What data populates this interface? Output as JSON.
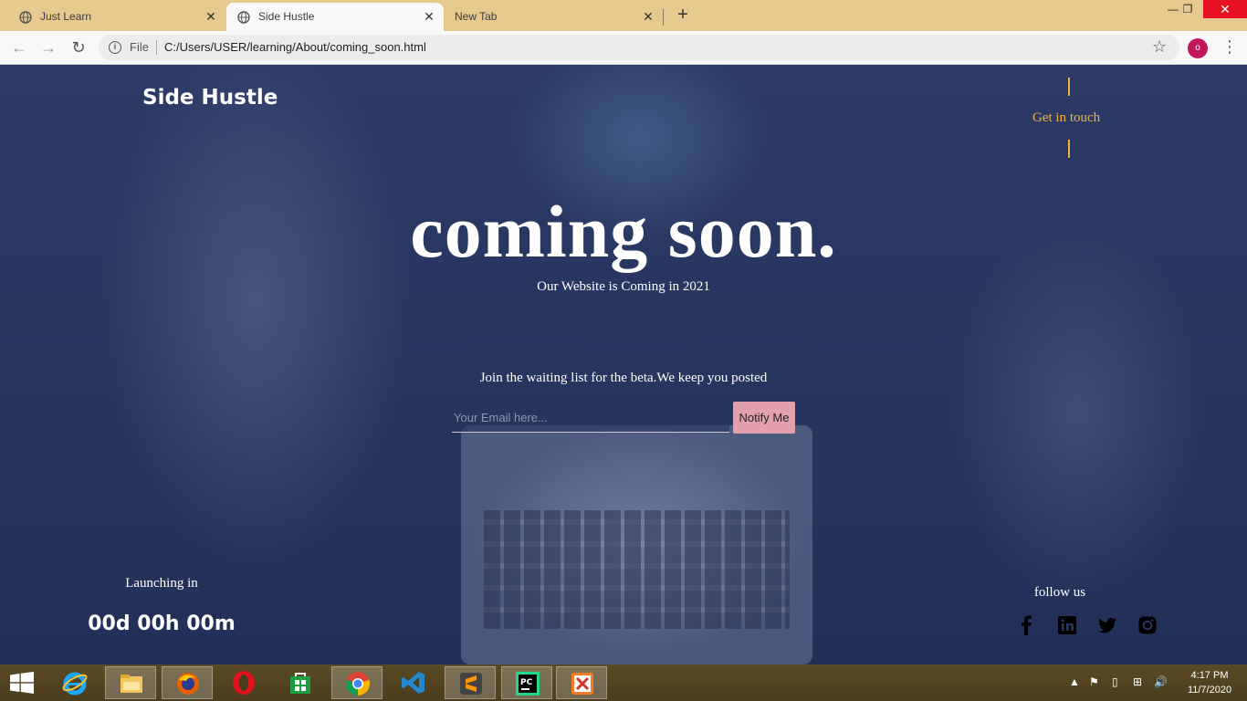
{
  "browser": {
    "tabs": [
      {
        "title": "Just Learn",
        "active": false
      },
      {
        "title": "Side Hustle",
        "active": true
      },
      {
        "title": "New Tab",
        "active": false
      }
    ],
    "scheme_label": "File",
    "url": "C:/Users/USER/learning/About/coming_soon.html",
    "profile_initial": "o"
  },
  "site": {
    "brand": "Side Hustle",
    "contact_link": "Get in touch",
    "headline": "coming soon.",
    "subline": "Our Website is Coming in 2021",
    "waitlist_text": "Join the waiting list for the beta.We keep you posted",
    "email_placeholder": "Your Email here...",
    "notify_label": "Notify Me",
    "launch_label": "Launching in",
    "countdown": "00d 00h 00m",
    "follow_label": "follow us",
    "socials": [
      "facebook-icon",
      "linkedin-icon",
      "twitter-icon",
      "instagram-icon"
    ],
    "accent_color": "#f0b43a",
    "button_color": "#e2a0ad"
  },
  "taskbar": {
    "apps": [
      "internet-explorer-icon",
      "file-explorer-icon",
      "firefox-icon",
      "opera-icon",
      "store-icon",
      "chrome-icon",
      "vscode-icon",
      "sublime-icon",
      "pycharm-icon",
      "xampp-icon"
    ],
    "time": "4:17 PM",
    "date": "11/7/2020"
  }
}
